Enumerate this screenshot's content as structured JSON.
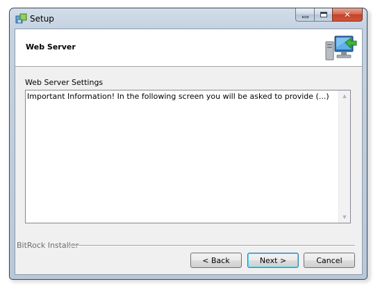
{
  "window": {
    "title": "Setup",
    "icon": "setup-installer-icon"
  },
  "caption_buttons": {
    "minimize_icon": "minimize-icon",
    "maximize_icon": "maximize-icon",
    "close_icon": "close-icon"
  },
  "header": {
    "title": "Web Server",
    "icon": "computer-network-icon"
  },
  "content": {
    "section_label": "Web Server Settings",
    "text": "Important Information! In the following screen you will be asked to provide (...)"
  },
  "footer": {
    "brand": "BitRock Installer"
  },
  "buttons": {
    "back": "< Back",
    "next": "Next >",
    "cancel": "Cancel"
  },
  "colors": {
    "frame": "#c4d2e1",
    "close_button": "#d0553c",
    "default_button_border": "#3c7fb1"
  }
}
